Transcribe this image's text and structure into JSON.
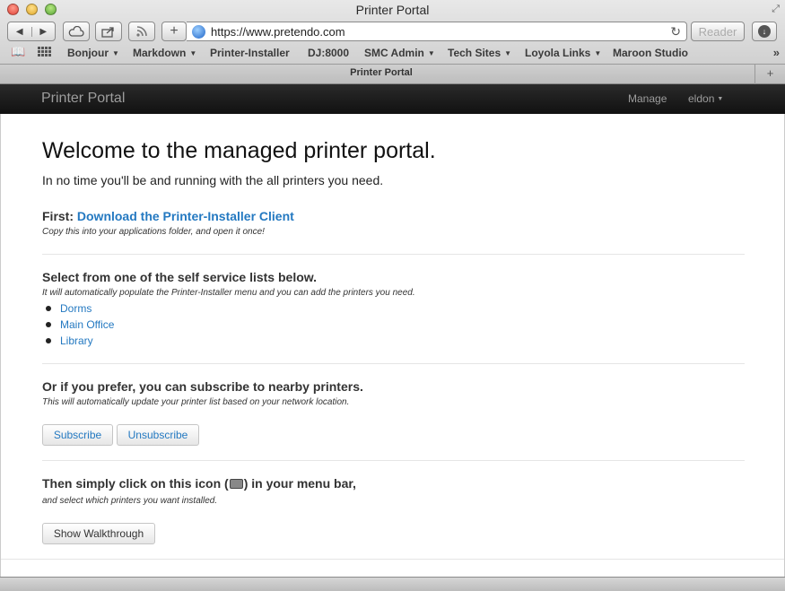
{
  "window": {
    "title": "Printer Portal"
  },
  "toolbar": {
    "url": "https://www.pretendo.com",
    "reader_label": "Reader"
  },
  "bookmarks": [
    {
      "label": "Bonjour",
      "has_menu": true
    },
    {
      "label": "Markdown",
      "has_menu": true
    },
    {
      "label": "Printer-Installer",
      "has_menu": false
    },
    {
      "label": "DJ:8000",
      "has_menu": false
    },
    {
      "label": "SMC Admin",
      "has_menu": true
    },
    {
      "label": "Tech Sites",
      "has_menu": true
    },
    {
      "label": "Loyola Links",
      "has_menu": true
    },
    {
      "label": "Maroon Studio",
      "has_menu": false
    }
  ],
  "tab": {
    "title": "Printer Portal"
  },
  "navbar": {
    "brand": "Printer Portal",
    "manage": "Manage",
    "user": "eldon"
  },
  "main": {
    "heading": "Welcome to the managed printer portal.",
    "lead": "In no time you'll be and running with the all printers you need.",
    "first": {
      "prefix": "First: ",
      "link": "Download the Printer-Installer Client",
      "note": "Copy this into your applications folder, and open it once!"
    },
    "lists": {
      "heading": "Select from one of the self service lists below.",
      "note": "It will automatically populate the Printer-Installer menu and you can add the printers you need.",
      "items": [
        "Dorms",
        "Main Office",
        "Library"
      ]
    },
    "subscribe": {
      "heading": "Or if you prefer, you can subscribe to nearby printers.",
      "note": "This will automatically update your printer list based on your network location.",
      "subscribe_label": "Subscribe",
      "unsubscribe_label": "Unsubscribe"
    },
    "walkthrough": {
      "heading_before": "Then simply click on this icon (",
      "heading_after": ") in your menu bar,",
      "note": "and select which printers you want installed.",
      "button_label": "Show Walkthrough"
    }
  },
  "icons": [
    "close-icon",
    "minimize-icon",
    "zoom-icon",
    "back-icon",
    "forward-icon",
    "icloud-icon",
    "share-icon",
    "rss-icon",
    "add-icon",
    "globe-icon",
    "reload-icon",
    "download-icon",
    "reading-list-icon",
    "top-sites-icon",
    "printer-icon"
  ]
}
